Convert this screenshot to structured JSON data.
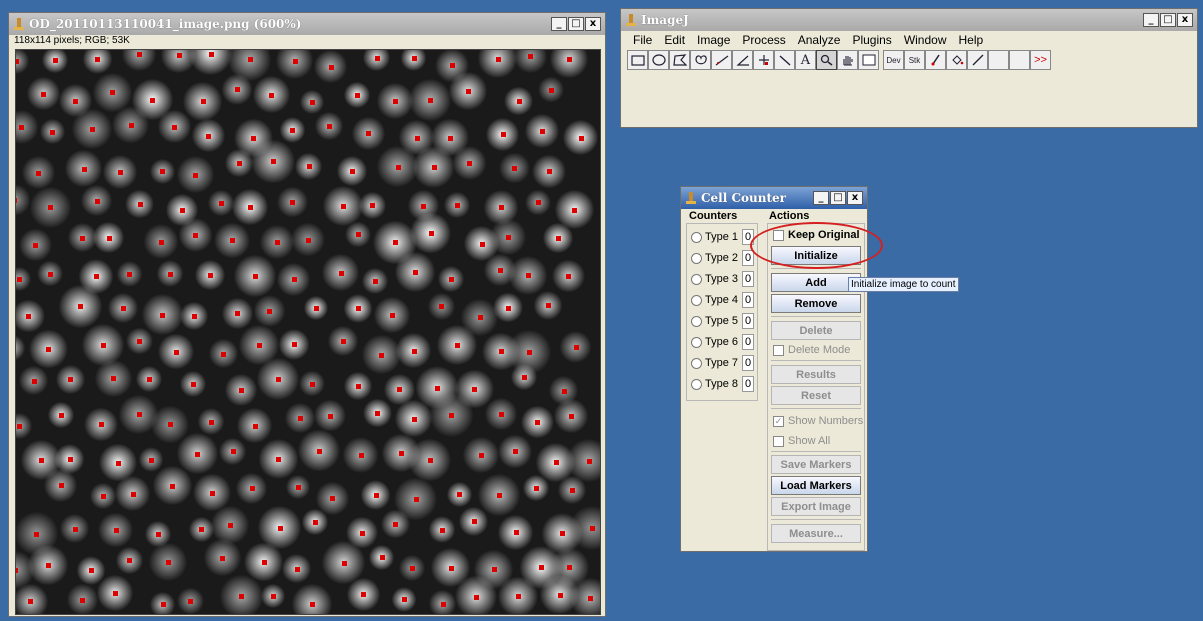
{
  "image_window": {
    "title": "OD_20110113110041_image.png (600%)",
    "info": "118x114 pixels; RGB; 53K"
  },
  "imagej_window": {
    "title": "ImageJ",
    "menu": [
      "File",
      "Edit",
      "Image",
      "Process",
      "Analyze",
      "Plugins",
      "Window",
      "Help"
    ],
    "tools": [
      "rectangle-tool-icon",
      "oval-tool-icon",
      "polygon-tool-icon",
      "freehand-tool-icon",
      "line-tool-icon",
      "angle-tool-icon",
      "point-tool-icon",
      "wand-tool-icon",
      "text-tool-icon",
      "magnifier-tool-icon",
      "hand-tool-icon",
      "color-picker-icon",
      "developer-menu-icon",
      "stack-menu-icon",
      "brush-tool-icon",
      "flood-fill-icon",
      "pencil-tool-icon",
      "more-tools-icon"
    ],
    "tool_labels": {
      "dev": "Dev",
      "stk": "Stk",
      "more": ">>",
      "text": "A"
    }
  },
  "cell_counter": {
    "title": "Cell Counter",
    "counters_header": "Counters",
    "actions_header": "Actions",
    "counters": [
      {
        "label": "Type 1",
        "count": "0"
      },
      {
        "label": "Type 2",
        "count": "0"
      },
      {
        "label": "Type 3",
        "count": "0"
      },
      {
        "label": "Type 4",
        "count": "0"
      },
      {
        "label": "Type 5",
        "count": "0"
      },
      {
        "label": "Type 6",
        "count": "0"
      },
      {
        "label": "Type 7",
        "count": "0"
      },
      {
        "label": "Type 8",
        "count": "0"
      }
    ],
    "keep_original": "Keep Original",
    "initialize": "Initialize",
    "add": "Add",
    "remove": "Remove",
    "delete": "Delete",
    "delete_mode": "Delete Mode",
    "results": "Results",
    "reset": "Reset",
    "show_numbers": "Show Numbers",
    "show_all": "Show All",
    "save_markers": "Save Markers",
    "load_markers": "Load Markers",
    "export_image": "Export Image",
    "measure": "Measure..."
  },
  "tooltip": "Initialize image to count",
  "window_buttons": {
    "minimize": "_",
    "maximize": "□",
    "close": "x"
  },
  "colors": {
    "desktop": "#3a6ba5",
    "marker": "#dd0000",
    "highlight": "#d42020"
  }
}
